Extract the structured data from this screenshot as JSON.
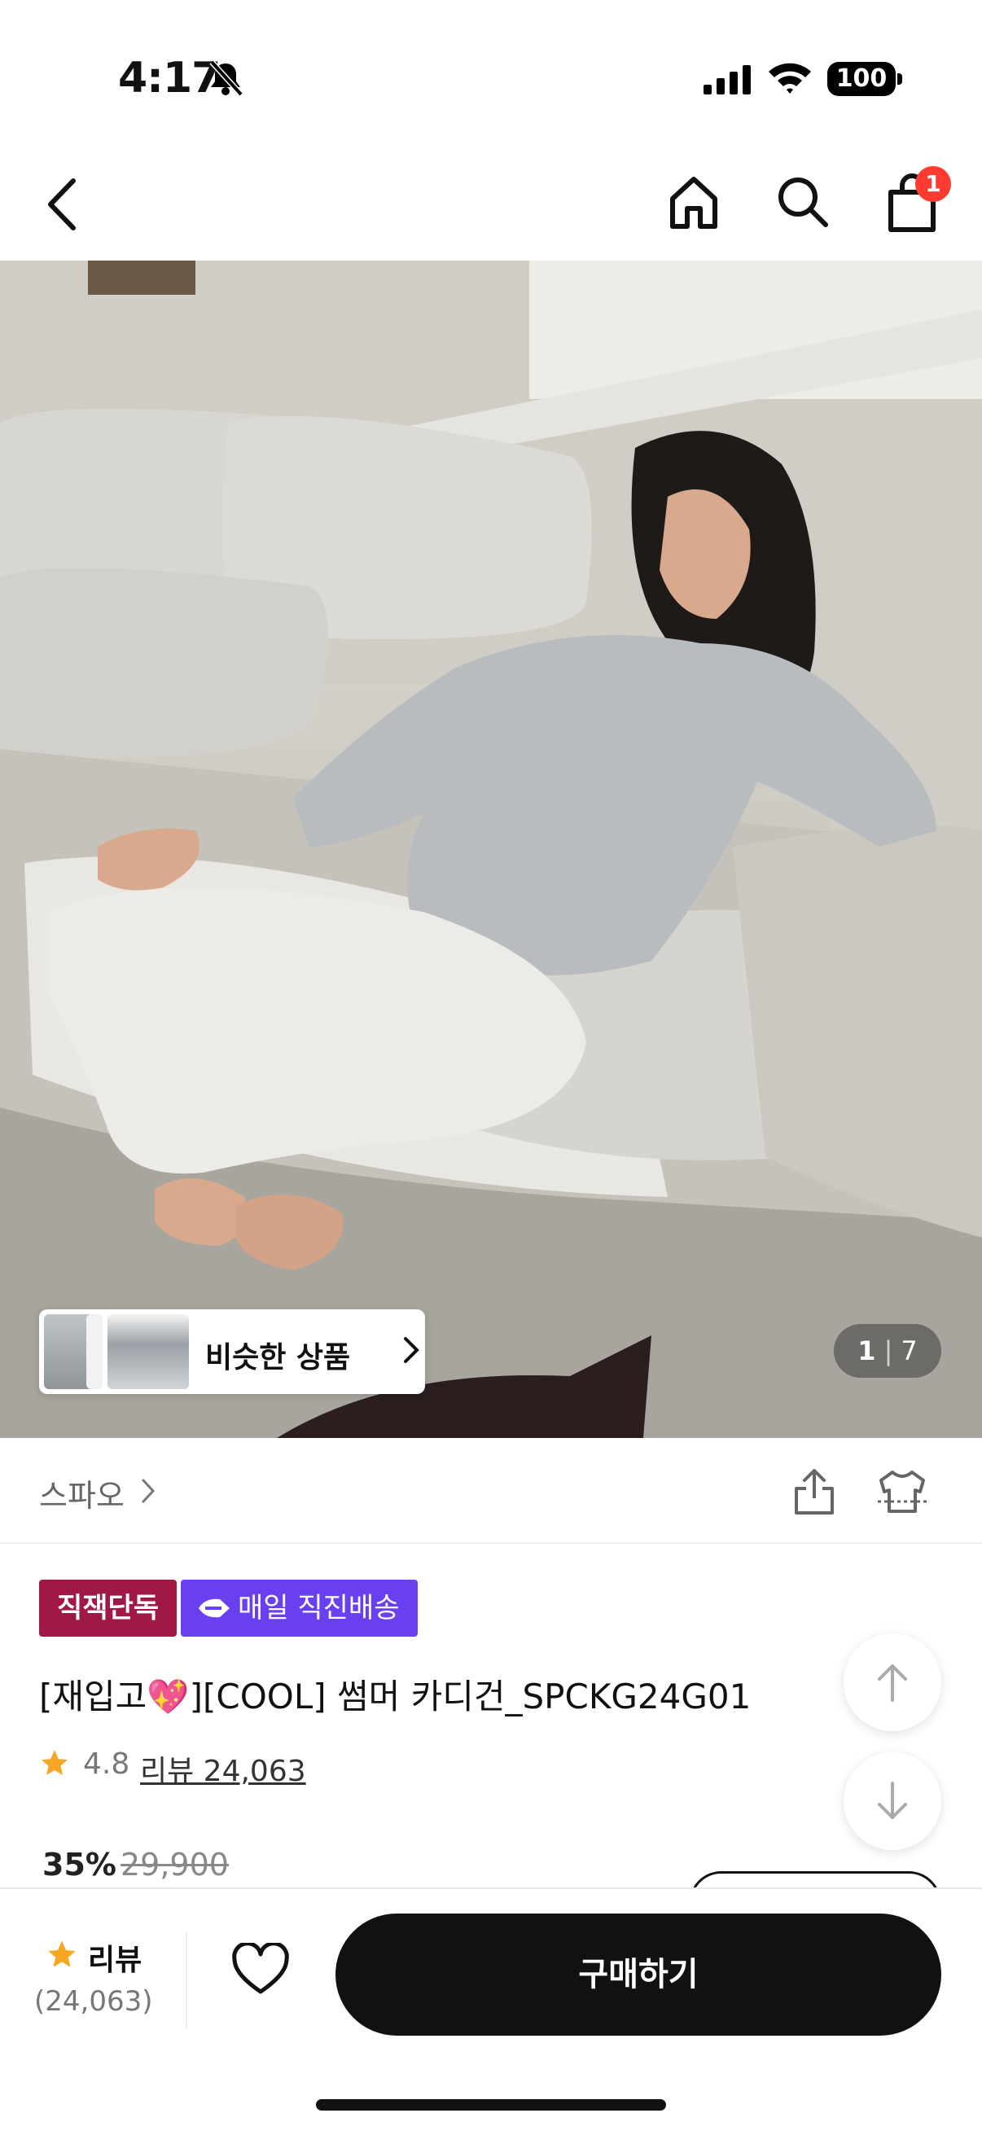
{
  "status_bar": {
    "time": "4:17",
    "battery": "100",
    "icons": [
      "bell-slash-icon",
      "signal-icon",
      "wifi-icon",
      "battery-icon"
    ]
  },
  "nav": {
    "icons": [
      "chevron-left-icon",
      "home-icon",
      "search-icon",
      "shopping-bag-icon"
    ],
    "cart_badge": "1"
  },
  "hero": {
    "similar_label": "비슷한 상품",
    "counter_current": "1",
    "counter_separator": "|",
    "counter_total": "7"
  },
  "brand_row": {
    "brand": "스파오",
    "icons": [
      "share-icon",
      "try-on-shirt-icon"
    ]
  },
  "product": {
    "tag_exclusive": "직잭단독",
    "tag_delivery": "매일 직진배송",
    "title": "[재입고💖][COOL] 썸머 카디건_SPCKG24G01",
    "rating": "4.8",
    "reviews": "리뷰 24,063",
    "discount": "35%",
    "original_price": "29,900"
  },
  "bottom_bar": {
    "review_label": "리뷰",
    "review_count": "(24,063)",
    "buy_label": "구매하기"
  },
  "colors": {
    "badge_red": "#ff3b2f",
    "tag_exclusive": "#a01844",
    "tag_delivery": "#6a3ff0",
    "star": "#f5a623",
    "buy_button": "#111111"
  }
}
